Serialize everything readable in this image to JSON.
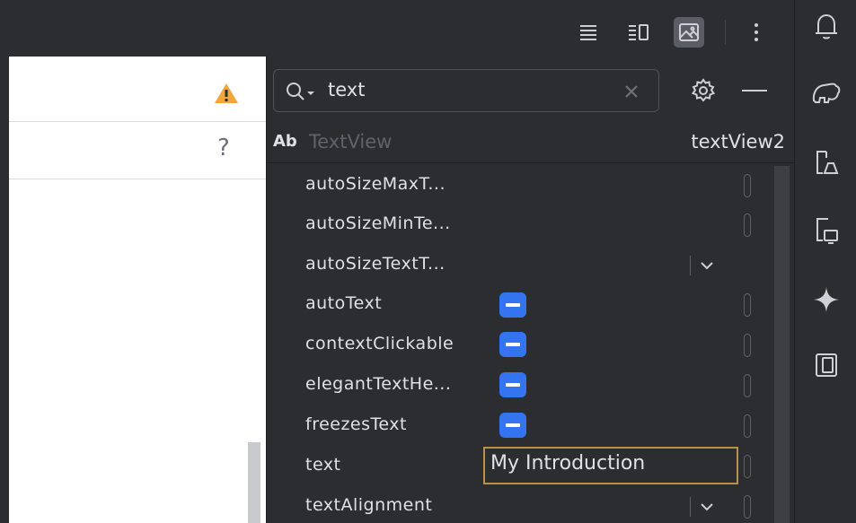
{
  "toolbar": {
    "buttons": [
      {
        "icon": "code-view-icon"
      },
      {
        "icon": "split-view-icon"
      },
      {
        "icon": "design-view-icon",
        "active": true
      },
      {
        "icon": "more-vertical-icon"
      }
    ]
  },
  "left_panel": {
    "warning_icon": "warning-icon",
    "help_label": "?"
  },
  "attributes": {
    "search": {
      "value": "text"
    },
    "header": {
      "type_badge": "Ab",
      "type_name": "TextView",
      "id": "textView2"
    },
    "rows": [
      {
        "name": "autoSizeMaxT...",
        "control": "bracket"
      },
      {
        "name": "autoSizeMinTe...",
        "control": "bracket"
      },
      {
        "name": "autoSizeTextT...",
        "control": "dropdown"
      },
      {
        "name": "autoText",
        "control": "checkbox"
      },
      {
        "name": "contextClickable",
        "control": "checkbox"
      },
      {
        "name": "elegantTextHe...",
        "control": "checkbox"
      },
      {
        "name": "freezesText",
        "control": "checkbox"
      },
      {
        "name": "text",
        "control": "input",
        "value": "My Introduction"
      },
      {
        "name": "textAlignment",
        "control": "dropdown"
      }
    ]
  },
  "colors": {
    "accent": "#3574f0",
    "warning": "#f2a73b",
    "focus_border": "#b8914a"
  }
}
